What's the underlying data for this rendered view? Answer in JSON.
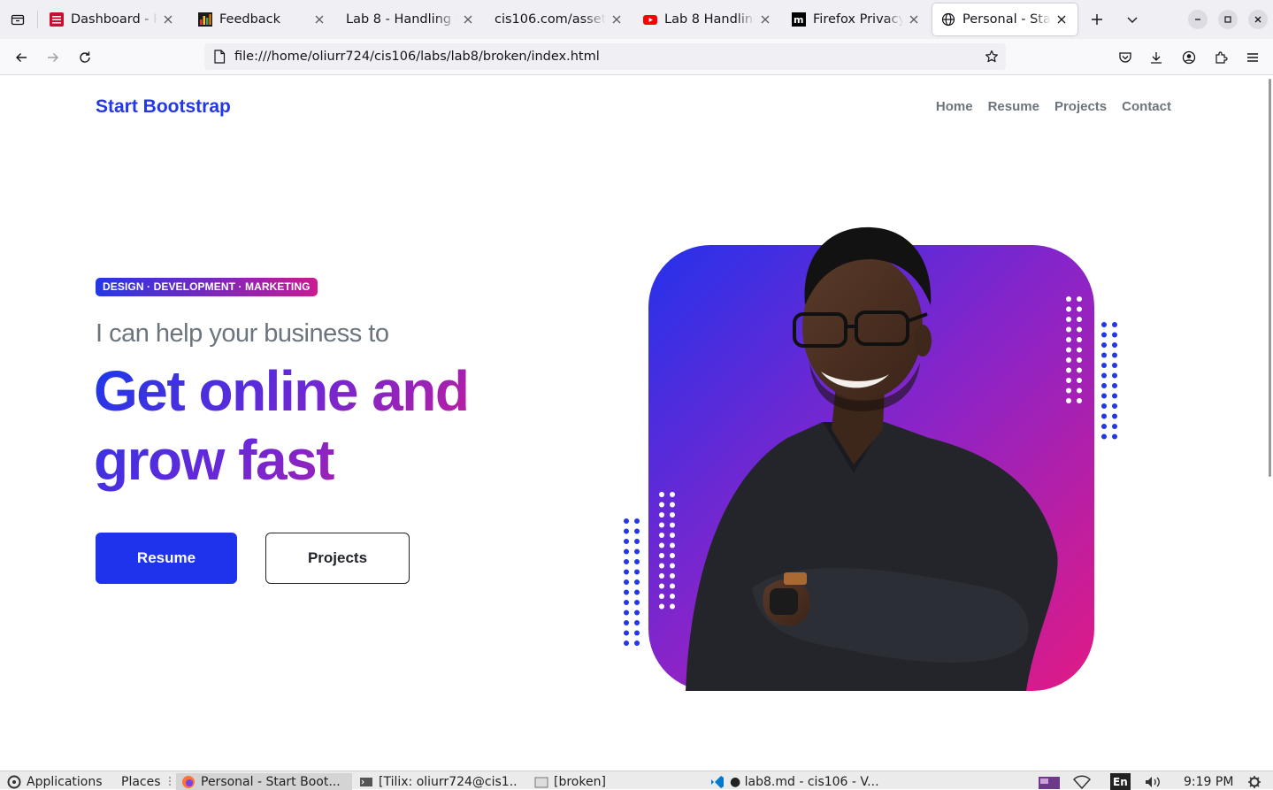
{
  "browser": {
    "tabs": [
      {
        "title": "Dashboard - Pass",
        "icon": "dashboard-icon",
        "active": false
      },
      {
        "title": "Feedback",
        "icon": "feedback-chart-icon",
        "active": false
      },
      {
        "title": "Lab 8 - Handling file",
        "icon": "",
        "active": false
      },
      {
        "title": "cis106.com/assets/l",
        "icon": "",
        "active": false
      },
      {
        "title": "Lab 8 Handling t",
        "icon": "youtube-icon",
        "active": false
      },
      {
        "title": "Firefox Privacy N",
        "icon": "mozilla-icon",
        "active": false
      },
      {
        "title": "Personal - Start B",
        "icon": "globe-icon",
        "active": true
      }
    ],
    "url": "file:///home/oliurr724/cis106/labs/lab8/broken/index.html"
  },
  "site": {
    "brand": "Start Bootstrap",
    "nav": [
      "Home",
      "Resume",
      "Projects",
      "Contact"
    ],
    "badge": "DESIGN · DEVELOPMENT · MARKETING",
    "subhead": "I can help your business to",
    "headline": "Get online and grow fast",
    "primary_button": "Resume",
    "secondary_button": "Projects",
    "colors": {
      "primary": "#1f33ec",
      "accent": "#d81b80",
      "gradient_start": "#2437e8",
      "gradient_end": "#d81b80"
    }
  },
  "panel": {
    "applications": "Applications",
    "places": "Places",
    "tasks": [
      {
        "label": "Personal - Start Boot...",
        "icon": "firefox-icon",
        "active": true
      },
      {
        "label": "[Tilix: oliurr724@cis1...",
        "icon": "terminal-icon",
        "active": false
      },
      {
        "label": "[broken]",
        "icon": "folder-icon",
        "active": false
      },
      {
        "label": "● lab8.md - cis106 - V...",
        "icon": "vscode-icon",
        "active": false
      }
    ],
    "keyboard": "En",
    "clock": "9:19 PM"
  }
}
